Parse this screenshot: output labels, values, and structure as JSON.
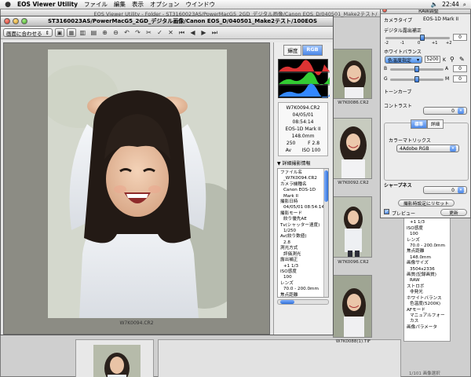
{
  "menubar": {
    "app_name": "EOS Viewer Utility",
    "items": [
      "ファイル",
      "編集",
      "表示",
      "オプション",
      "ウインドウ"
    ],
    "clock": "22:44",
    "accent": "#2f6fd6"
  },
  "bg_window": {
    "title": "EOS Viewer Utility - Folder - ST3160023AS/PowerMacG5_2GD_デジタル画像/Canon EOS_D/040501_Make2テスト/"
  },
  "main_window": {
    "title": "ST3160023AS/PowerMacG5_2GD_デジタル画像/Canon EOS_D/040501_Make2テスト/100EOS1D/...",
    "zoom_popup": "画面に合わせる",
    "photo_caption": "W7K0094.CR2"
  },
  "info_panel": {
    "tabs": [
      "輝度",
      "RGB"
    ],
    "file": "W7K0094.CR2",
    "date": "04/05/01",
    "time": "08:54:14",
    "camera": "EOS-1D Mark II",
    "focal": "148.0mm",
    "shutter": "250",
    "aperture": "F 2.8",
    "mode": "Av",
    "iso": "ISO 100",
    "detail_header": "▼ 詳細撮影情報",
    "details": [
      [
        "ファイル名",
        "_W7K0094.CR2"
      ],
      [
        "カメラ機種名",
        "Canon EOS-1D Mark II"
      ],
      [
        "撮影日時",
        "04/05/01 08:54:14"
      ],
      [
        "撮影モード",
        "絞り優先AE"
      ],
      [
        "Tv(シャッター速度)",
        "1/250"
      ],
      [
        "Av(絞り数値)",
        "2.8"
      ],
      [
        "測光方式",
        "評価測光"
      ],
      [
        "露出補正",
        "+1 1/3"
      ],
      [
        "ISO感度",
        "100"
      ],
      [
        "レンズ",
        "70.0 - 200.0mm"
      ],
      [
        "焦点距離",
        "148.0mm"
      ],
      [
        "画像サイズ",
        "3504x2336"
      ]
    ]
  },
  "thumbnails": [
    {
      "caption": "W7K0086.CR2"
    },
    {
      "caption": "W7K0092.CR2"
    },
    {
      "caption": "W7K0096.CR2"
    },
    {
      "caption": "W7K0088(1).TIF"
    }
  ],
  "raw_panel": {
    "title": "RAW調整",
    "camera_label": "カメラタイプ",
    "camera_value": "EOS-1D Mark II",
    "exposure_label": "デジタル露出補正",
    "exposure_value": "0",
    "exposure_scale": [
      "-2",
      "-1",
      "0",
      "+1",
      "+2"
    ],
    "wb_label": "ホワイトバランス",
    "wb_value": "色温度指定",
    "kelvin": "5200",
    "kelvin_unit": "K",
    "wb_b": "B",
    "wb_a": "A",
    "wb_g": "G",
    "wb_m": "M",
    "wb_b_value": "0",
    "wb_g_value": "0",
    "tone_label": "トーンカーブ",
    "contrast_label": "コントラスト",
    "contrast_value": "0",
    "tab_standard": "標準",
    "tab_detail": "詳細",
    "color_matrix_label": "カラーマトリックス",
    "color_matrix_value": "4Adobe RGB",
    "sharpness_label": "シャープネス",
    "sharpness_value": "0",
    "reset_button": "撮影時設定にリセット",
    "preview_label": "プレビュー",
    "update_button": "更新"
  },
  "right_list": [
    [
      "撮影モード",
      ""
    ],
    [
      "",
      "+1 1/3"
    ],
    [
      "ISO感度",
      ""
    ],
    [
      "",
      "100"
    ],
    [
      "レンズ",
      ""
    ],
    [
      "",
      "70.0 - 200.0mm"
    ],
    [
      "焦点距離",
      ""
    ],
    [
      "",
      "148.0mm"
    ],
    [
      "画像サイズ",
      ""
    ],
    [
      "",
      "3504x2336"
    ],
    [
      "画質(記録画質)",
      ""
    ],
    [
      "",
      "RAW"
    ],
    [
      "ストロボ",
      ""
    ],
    [
      "",
      "非発光"
    ],
    [
      "ホワイトバランス",
      ""
    ],
    [
      "",
      "色温度(5200K)"
    ],
    [
      "AFモード",
      ""
    ],
    [
      "",
      "マニュアルフォーカス"
    ],
    [
      "画像パラメータ",
      ""
    ]
  ],
  "status_text": "1/101 画像選択"
}
